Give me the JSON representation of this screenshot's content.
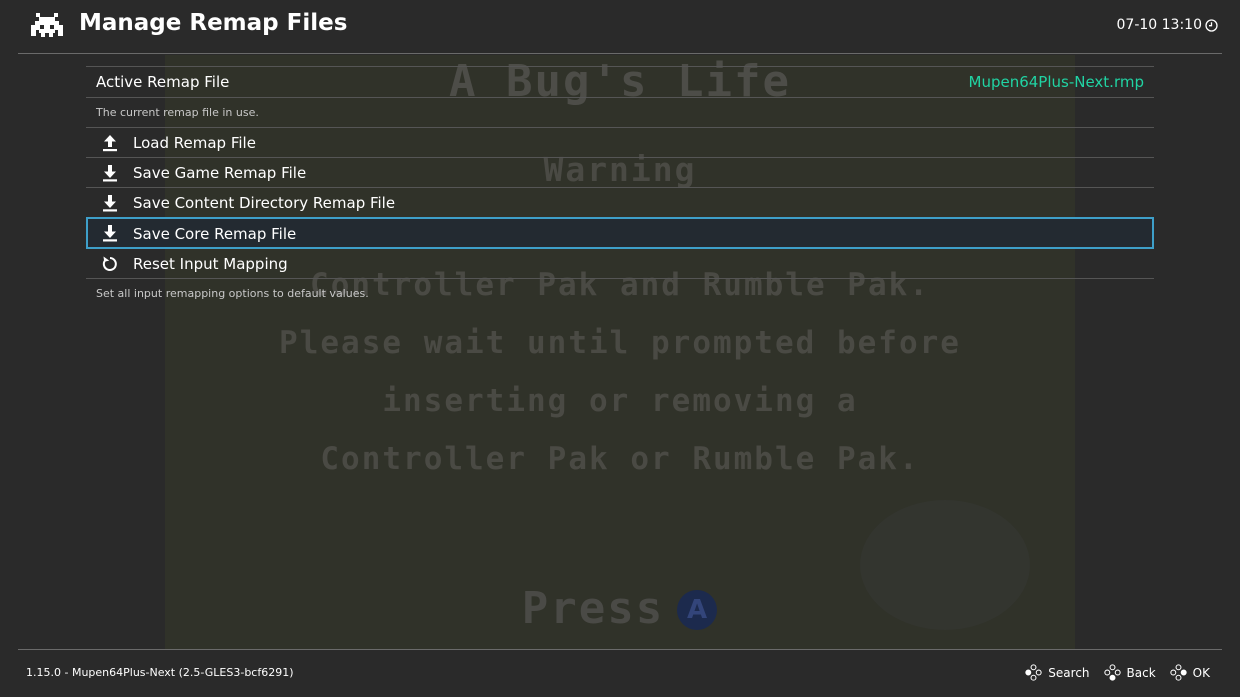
{
  "header": {
    "title": "Manage Remap Files",
    "clock": "07-10 13:10",
    "logo_icon": "retroarch-invader-icon",
    "clock_icon": "clock-icon"
  },
  "background_game": {
    "title": "A Bug's Life",
    "warning": "Warning",
    "lines": [
      "Controller Pak and Rumble Pak.",
      "Please wait until prompted before",
      "inserting or removing a",
      "Controller Pak or Rumble Pak."
    ],
    "press": "Press",
    "press_button": "A"
  },
  "menu": {
    "active_remap": {
      "label": "Active Remap File",
      "value": "Mupen64Plus-Next.rmp",
      "sublabel": "The current remap file in use."
    },
    "items": [
      {
        "label": "Load Remap File",
        "icon": "upload-icon"
      },
      {
        "label": "Save Game Remap File",
        "icon": "download-icon"
      },
      {
        "label": "Save Content Directory Remap File",
        "icon": "download-icon"
      },
      {
        "label": "Save Core Remap File",
        "icon": "download-icon"
      },
      {
        "label": "Reset Input Mapping",
        "icon": "reset-icon"
      }
    ],
    "selected_index": 3,
    "help_text": "Set all input remapping options to default values."
  },
  "footer": {
    "version": "1.15.0 - Mupen64Plus-Next (2.5-GLES3-bcf6291)",
    "hints": [
      {
        "label": "Search",
        "icon": "gamepad-button-icon"
      },
      {
        "label": "Back",
        "icon": "gamepad-button-icon"
      },
      {
        "label": "OK",
        "icon": "gamepad-button-icon"
      }
    ]
  },
  "colors": {
    "accent_value": "#21d3a3",
    "selection_border": "#3e9fc9",
    "background": "#2a2a2a"
  }
}
